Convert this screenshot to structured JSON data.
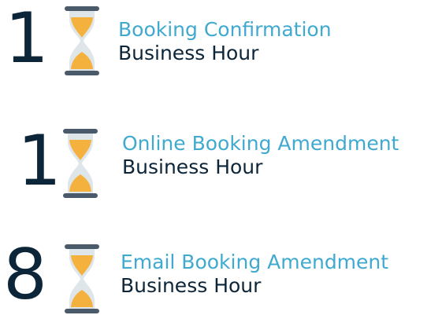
{
  "items": [
    {
      "number": "1",
      "title": "Booking Confirmation",
      "subtitle": "Business Hour",
      "icon": "hourglass-icon"
    },
    {
      "number": "1",
      "title": "Online Booking Amendment",
      "subtitle": "Business Hour",
      "icon": "hourglass-icon"
    },
    {
      "number": "8",
      "title": "Email Booking Amendment",
      "subtitle": "Business Hour",
      "icon": "hourglass-icon"
    }
  ],
  "colors": {
    "number": "#0d2538",
    "title": "#3fa9cf",
    "subtitle": "#0d2538",
    "hourglass_frame": "#4a5a6a",
    "hourglass_glass": "#dfe6ea",
    "hourglass_sand": "#f4b13d"
  }
}
